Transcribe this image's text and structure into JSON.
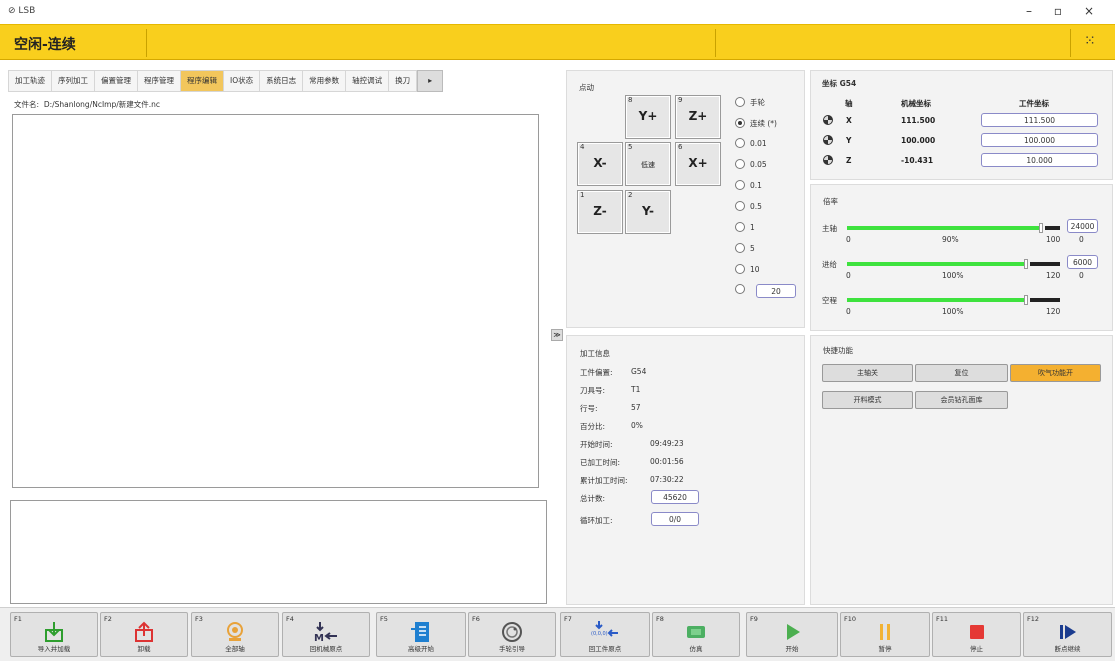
{
  "window": {
    "title": "LSB",
    "minimize": "–",
    "maximize": "▫",
    "close": "×"
  },
  "header": {
    "status": "空闲-连续",
    "grid_icon": "⁙"
  },
  "tabs": [
    "加工轨迹",
    "序列加工",
    "偏置管理",
    "程序管理",
    "程序编辑",
    "IO状态",
    "系统日志",
    "常用参数",
    "轴控调试",
    "换刀"
  ],
  "active_tab": "程序编辑",
  "tab_arrow": "▸",
  "file": {
    "label": "文件名:",
    "path": "D:/Shanlong/NcImp/新建文件.nc"
  },
  "splitter": "≫",
  "jog": {
    "title": "点动",
    "keys": [
      {
        "num": "8",
        "label": "Y+"
      },
      {
        "num": "9",
        "label": "Z+"
      },
      {
        "num": "4",
        "label": "X-"
      },
      {
        "num": "5",
        "label": "低速"
      },
      {
        "num": "6",
        "label": "X+"
      },
      {
        "num": "1",
        "label": "Z-"
      },
      {
        "num": "2",
        "label": "Y-"
      }
    ],
    "modes": [
      "手轮",
      "连续 (*)",
      "0.01",
      "0.05",
      "0.1",
      "0.5",
      "1",
      "5",
      "10"
    ],
    "selected_mode": "连续 (*)",
    "custom_step": "20"
  },
  "coords": {
    "title": "坐标 G54",
    "headers": [
      "轴",
      "机械坐标",
      "工件坐标"
    ],
    "rows": [
      {
        "axis": "X",
        "machine": "111.500",
        "work": "111.500"
      },
      {
        "axis": "Y",
        "machine": "100.000",
        "work": "100.000"
      },
      {
        "axis": "Z",
        "machine": "-10.431",
        "work": "10.000"
      }
    ]
  },
  "rates": {
    "title": "倍率",
    "items": [
      {
        "name": "主轴",
        "min": "0",
        "pct": "90%",
        "max": "100",
        "fill": 0.9,
        "value": "24000",
        "cur": "0"
      },
      {
        "name": "进给",
        "min": "0",
        "pct": "100%",
        "max": "120",
        "fill": 0.833,
        "value": "6000",
        "cur": "0"
      },
      {
        "name": "空程",
        "min": "0",
        "pct": "100%",
        "max": "120",
        "fill": 0.833
      }
    ]
  },
  "machining": {
    "title": "加工信息",
    "offset_label": "工件偏置:",
    "offset": "G54",
    "tool_label": "刀具号:",
    "tool": "T1",
    "line_label": "行号:",
    "line": "57",
    "percent_label": "百分比:",
    "percent": "0%",
    "start_label": "开始时间:",
    "start": "09:49:23",
    "elapsed_label": "已加工时间:",
    "elapsed": "00:01:56",
    "total_time_label": "累计加工时间:",
    "total_time": "07:30:22",
    "count_label": "总计数:",
    "count": "45620",
    "loop_label": "循环加工:",
    "loop": "0/0"
  },
  "quick": {
    "title": "快捷功能",
    "buttons": [
      "主轴关",
      "复位",
      "吹气功能开",
      "开料模式",
      "会员钻孔面库"
    ]
  },
  "fkeys": [
    {
      "key": "F1",
      "label": "导入并加载",
      "icon": "import-icon"
    },
    {
      "key": "F2",
      "label": "卸载",
      "icon": "unload-icon"
    },
    {
      "key": "F3",
      "label": "全部轴",
      "icon": "all-axis-icon"
    },
    {
      "key": "F4",
      "label": "回机械原点",
      "icon": "home-machine-icon"
    },
    {
      "key": "F5",
      "label": "高级开始",
      "icon": "advanced-start-icon"
    },
    {
      "key": "F6",
      "label": "手轮引导",
      "icon": "handwheel-icon"
    },
    {
      "key": "F7",
      "label": "回工件原点",
      "icon": "home-work-icon"
    },
    {
      "key": "F8",
      "label": "仿真",
      "icon": "simulate-icon"
    },
    {
      "key": "F9",
      "label": "开始",
      "icon": "play-icon"
    },
    {
      "key": "F10",
      "label": "暂停",
      "icon": "pause-icon"
    },
    {
      "key": "F11",
      "label": "停止",
      "icon": "stop-icon"
    },
    {
      "key": "F12",
      "label": "断点继续",
      "icon": "resume-icon"
    }
  ],
  "icon_text": {
    "m_letter": "M",
    "origin_coord": "(0,0,0)"
  },
  "colors": {
    "header": "#f9cf1d",
    "active_tab": "#f2c65c",
    "green": "#3ee23e",
    "orange": "#f4b030",
    "stop": "#e53935"
  }
}
